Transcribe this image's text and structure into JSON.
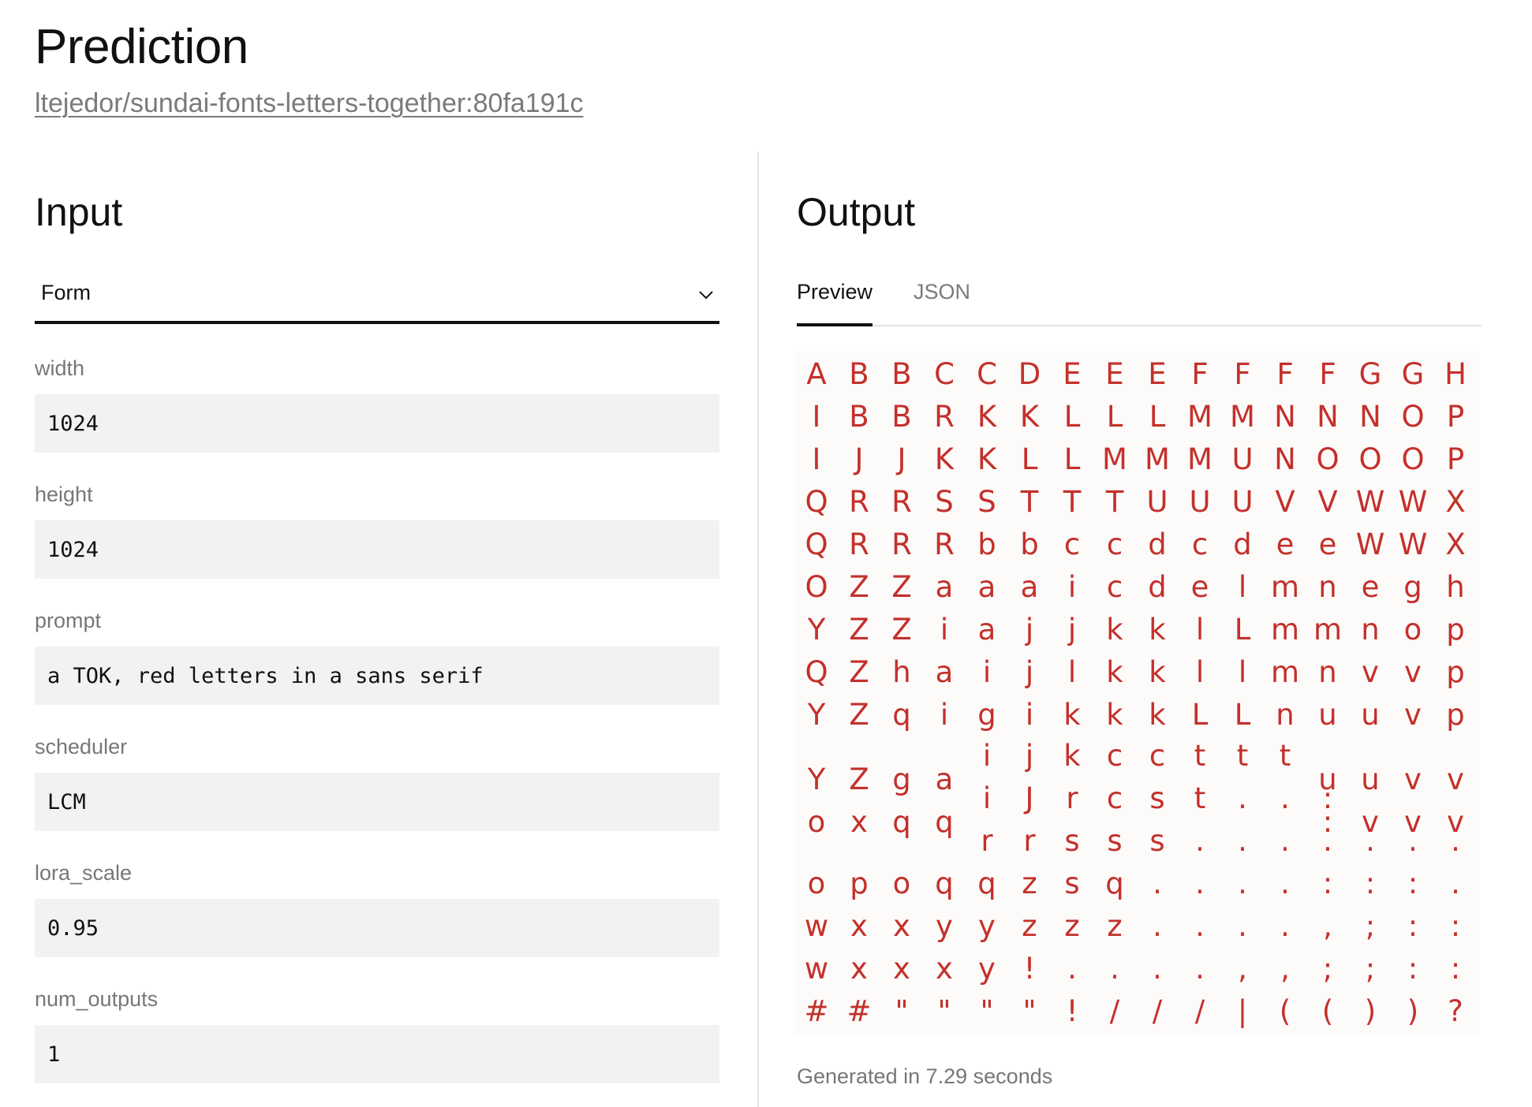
{
  "page": {
    "title": "Prediction",
    "model_ref": "ltejedor/sundai-fonts-letters-together:80fa191c"
  },
  "input": {
    "heading": "Input",
    "mode_select": {
      "value": "Form",
      "icon": "chevron-down-icon"
    },
    "fields": [
      {
        "name": "width",
        "value": "1024"
      },
      {
        "name": "height",
        "value": "1024"
      },
      {
        "name": "prompt",
        "value": "a TOK, red letters in a sans serif"
      },
      {
        "name": "scheduler",
        "value": "LCM"
      },
      {
        "name": "lora_scale",
        "value": "0.95"
      },
      {
        "name": "num_outputs",
        "value": "1"
      }
    ]
  },
  "output": {
    "heading": "Output",
    "tabs": [
      {
        "label": "Preview",
        "active": true
      },
      {
        "label": "JSON",
        "active": false
      }
    ],
    "generated_text": "Generated in 7.29 seconds",
    "glyph_color": "#c4302b",
    "glyph_rows": [
      [
        "A",
        "B",
        "B",
        "C",
        "C",
        "D",
        "E",
        "E",
        "E",
        "F",
        "F",
        "F",
        "F",
        "G",
        "G",
        "H"
      ],
      [
        "I",
        "B",
        "B",
        "R",
        "K",
        "K",
        "L",
        "L",
        "L",
        "M",
        "M",
        "N",
        "N",
        "N",
        "O",
        "P"
      ],
      [
        "I",
        "J",
        "J",
        "K",
        "K",
        "L",
        "L",
        "M",
        "M",
        "M",
        "U",
        "N",
        "O",
        "O",
        "O",
        "P"
      ],
      [
        "Q",
        "R",
        "R",
        "S",
        "S",
        "T",
        "T",
        "T",
        "U",
        "U",
        "U",
        "V",
        "V",
        "W",
        "W",
        "X"
      ],
      [
        "Q",
        "R",
        "R",
        "R",
        "b",
        "b",
        "c",
        "c",
        "d",
        "c",
        "d",
        "e",
        "e",
        "W",
        "W",
        "X"
      ],
      [
        "O",
        "Z",
        "Z",
        "a",
        "a",
        "a",
        "i",
        "c",
        "d",
        "e",
        "l",
        "m",
        "n",
        "e",
        "g",
        "h"
      ],
      [
        "Y",
        "Z",
        "Z",
        "i",
        "a",
        "j",
        "j",
        "k",
        "k",
        "l",
        "L",
        "m",
        "m",
        "n",
        "o",
        "p"
      ],
      [
        "Q",
        "Z",
        "h",
        "a",
        "i",
        "j",
        "l",
        "k",
        "k",
        "l",
        "l",
        "m",
        "n",
        "v",
        "v",
        "p"
      ],
      [
        "Y",
        "Z",
        "q",
        "i",
        "g",
        "i",
        "k",
        "k",
        "k",
        "L",
        "L",
        "n",
        "u",
        "u",
        "v",
        "p"
      ],
      [
        "",
        "",
        "",
        "",
        "i",
        "j",
        "k",
        "c",
        "c",
        "t",
        "t",
        "t",
        "",
        "",
        "",
        ""
      ],
      [
        "Y",
        "Z",
        "g",
        "a",
        "",
        "",
        "",
        "",
        "",
        "",
        "",
        "",
        "u",
        "u",
        "v",
        "v"
      ],
      [
        "",
        "",
        "",
        "",
        "i",
        "J",
        "r",
        "c",
        "s",
        "t",
        ".",
        ".",
        ":",
        "",
        "",
        ""
      ],
      [
        "o",
        "x",
        "q",
        "q",
        "",
        "",
        "",
        "",
        "",
        "",
        "",
        "",
        ":",
        "v",
        "v",
        "v"
      ],
      [
        "",
        "",
        "",
        "",
        "r",
        "r",
        "s",
        "s",
        "s",
        ".",
        ".",
        ".",
        ".",
        ".",
        ".",
        "."
      ],
      [
        "o",
        "p",
        "o",
        "q",
        "q",
        "z",
        "s",
        "q",
        ".",
        ".",
        ".",
        ".",
        ":",
        ":",
        ":",
        "."
      ],
      [
        "w",
        "x",
        "x",
        "y",
        "y",
        "z",
        "z",
        "z",
        ".",
        ".",
        ".",
        ".",
        ",",
        ";",
        ":",
        ":"
      ],
      [
        "w",
        "x",
        "x",
        "x",
        "y",
        "!",
        ".",
        ".",
        ".",
        ".",
        ",",
        ",",
        ";",
        ";",
        ":",
        ":"
      ],
      [
        "#",
        "#",
        "\"",
        "\"",
        "\"",
        "\"",
        "!",
        "/",
        "/",
        "/",
        "|",
        "(",
        "(",
        ")",
        ")",
        "?"
      ]
    ]
  }
}
